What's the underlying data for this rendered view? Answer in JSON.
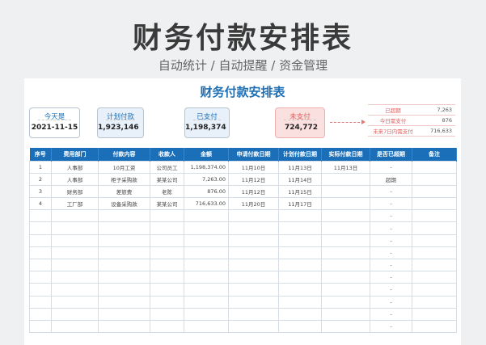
{
  "header": {
    "title": "财务付款安排表",
    "subtitle": "自动统计 / 自动提醒 / 资金管理"
  },
  "card_title": "财务付款安排表",
  "kpis": {
    "today_label": "今天是",
    "today": "2021-11-15",
    "planned_label": "计划付款",
    "planned": "1,923,146",
    "paid_label": "已支付",
    "paid": "1,198,374",
    "unpaid_label": "未支付",
    "unpaid": "724,772"
  },
  "summary": [
    {
      "label": "已超期",
      "value": "7,263"
    },
    {
      "label": "今日需支付",
      "value": "876"
    },
    {
      "label": "未来7日内需支付",
      "value": "716,633"
    }
  ],
  "table": {
    "headers": [
      "序号",
      "费用部门",
      "付款内容",
      "收款人",
      "金额",
      "申请付款日期",
      "计划付款日期",
      "实际付款日期",
      "是否已超期",
      "备注"
    ],
    "rows": [
      [
        "1",
        "人事部",
        "10月工资",
        "公司员工",
        "1,198,374.00",
        "11月10日",
        "11月13日",
        "11月13日",
        "-",
        ""
      ],
      [
        "2",
        "人事部",
        "柜子采购款",
        "某某公司",
        "7,263.00",
        "11月12日",
        "11月14日",
        "",
        "超期",
        ""
      ],
      [
        "3",
        "财务部",
        "差旅费",
        "老陈",
        "876.00",
        "11月12日",
        "11月15日",
        "",
        "-",
        ""
      ],
      [
        "4",
        "工厂部",
        "设备采购款",
        "某某公司",
        "716,633.00",
        "11月20日",
        "11月17日",
        "",
        "-",
        ""
      ],
      [
        "",
        "",
        "",
        "",
        "",
        "",
        "",
        "",
        "-",
        ""
      ],
      [
        "",
        "",
        "",
        "",
        "",
        "",
        "",
        "",
        "-",
        ""
      ],
      [
        "",
        "",
        "",
        "",
        "",
        "",
        "",
        "",
        "-",
        ""
      ],
      [
        "",
        "",
        "",
        "",
        "",
        "",
        "",
        "",
        "-",
        ""
      ],
      [
        "",
        "",
        "",
        "",
        "",
        "",
        "",
        "",
        "-",
        ""
      ],
      [
        "",
        "",
        "",
        "",
        "",
        "",
        "",
        "",
        "-",
        ""
      ],
      [
        "",
        "",
        "",
        "",
        "",
        "",
        "",
        "",
        "-",
        ""
      ],
      [
        "",
        "",
        "",
        "",
        "",
        "",
        "",
        "",
        "-",
        ""
      ],
      [
        "",
        "",
        "",
        "",
        "",
        "",
        "",
        "",
        "-",
        ""
      ],
      [
        "",
        "",
        "",
        "",
        "",
        "",
        "",
        "",
        "-",
        ""
      ]
    ]
  },
  "colors": {
    "accent": "#1a6fb8",
    "alert": "#e06060"
  }
}
